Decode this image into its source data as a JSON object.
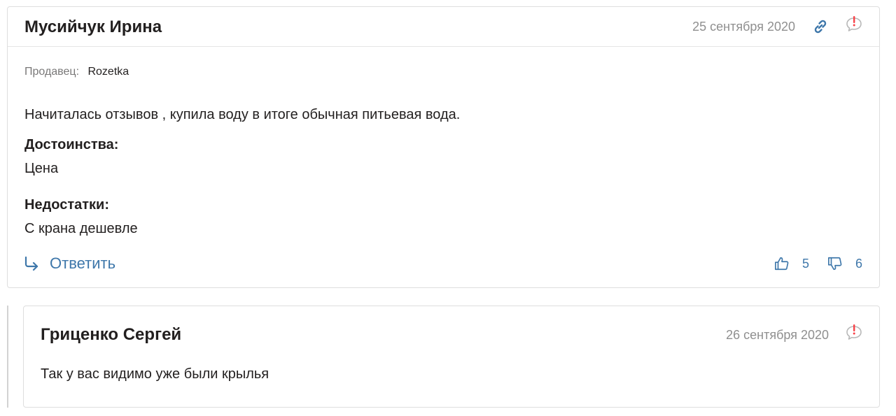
{
  "review": {
    "author": "Мусийчук Ирина",
    "date": "25 сентября 2020",
    "seller_label": "Продавец:",
    "seller_name": "Rozetka",
    "text": "Начиталась отзывов , купила воду в итоге обычная питьевая вода.",
    "pros_label": "Достоинства:",
    "pros": "Цена",
    "cons_label": "Недостатки:",
    "cons": "С крана дешевле",
    "reply_label": "Ответить",
    "likes": "5",
    "dislikes": "6"
  },
  "comment": {
    "author": "Гриценко Сергей",
    "date": "26 сентября 2020",
    "text": "Так у вас видимо уже были крылья"
  },
  "icons": {
    "link": "link-icon",
    "complain": "complain-icon",
    "reply": "reply-arrow-icon",
    "like": "thumbs-up-icon",
    "dislike": "thumbs-down-icon"
  },
  "colors": {
    "accent": "#3e77aa",
    "alert": "#f84147",
    "muted": "#8f8f8f",
    "border": "#dedede"
  }
}
